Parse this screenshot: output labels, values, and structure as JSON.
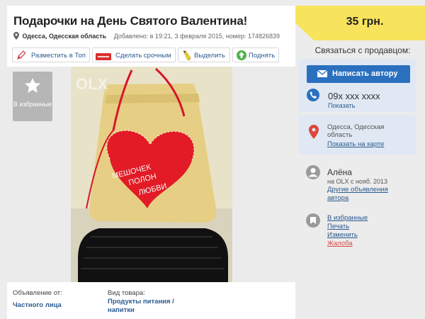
{
  "listing": {
    "title": "Подарочки на День Святого Валентина!",
    "location": "Одесса, Одесская область",
    "added": "Добавлено: в 19:21, 3 февраля 2015, номер: 174826839"
  },
  "actions": [
    {
      "label": "Разместить в Топ",
      "icon": "rocket-icon"
    },
    {
      "label": "Сделать срочным",
      "icon": "urgent-tag-icon"
    },
    {
      "label": "Выделить",
      "icon": "pencil-icon"
    },
    {
      "label": "Поднять",
      "icon": "lift-icon"
    }
  ],
  "favorite_box": {
    "label": "В избранные"
  },
  "photo": {
    "watermark": "OLX",
    "sign_line1": "МЕШОЧЕК",
    "sign_line2": "ПОЛОН",
    "sign_line3": "ЛЮБВИ"
  },
  "details": {
    "from_label": "Объявление от:",
    "from_value": "Частного лица",
    "type_label": "Вид товара:",
    "type_value": "Продукты питания / напитки"
  },
  "price": "35 грн.",
  "sidebar": {
    "contact_label": "Связаться с продавцом:",
    "write_button": "Написать автору",
    "phone": "09x xxx xxxx",
    "show_phone": "Показать",
    "location": "Одесса, Одесская область",
    "show_map": "Показать на карте",
    "seller_name": "Алёна",
    "seller_since": "на OLX с нояб. 2013",
    "other_ads": "Другие объявления автора",
    "links": {
      "favorites": "В избранные",
      "print": "Печать",
      "edit": "Изменить",
      "complaint": "Жалоба"
    }
  },
  "colors": {
    "accent_blue": "#2a70bf",
    "link_blue": "#2b5a8f",
    "price_yellow": "#f8e45c",
    "panel_bg": "#dfe8f3",
    "complaint_red": "#d34a4a"
  }
}
